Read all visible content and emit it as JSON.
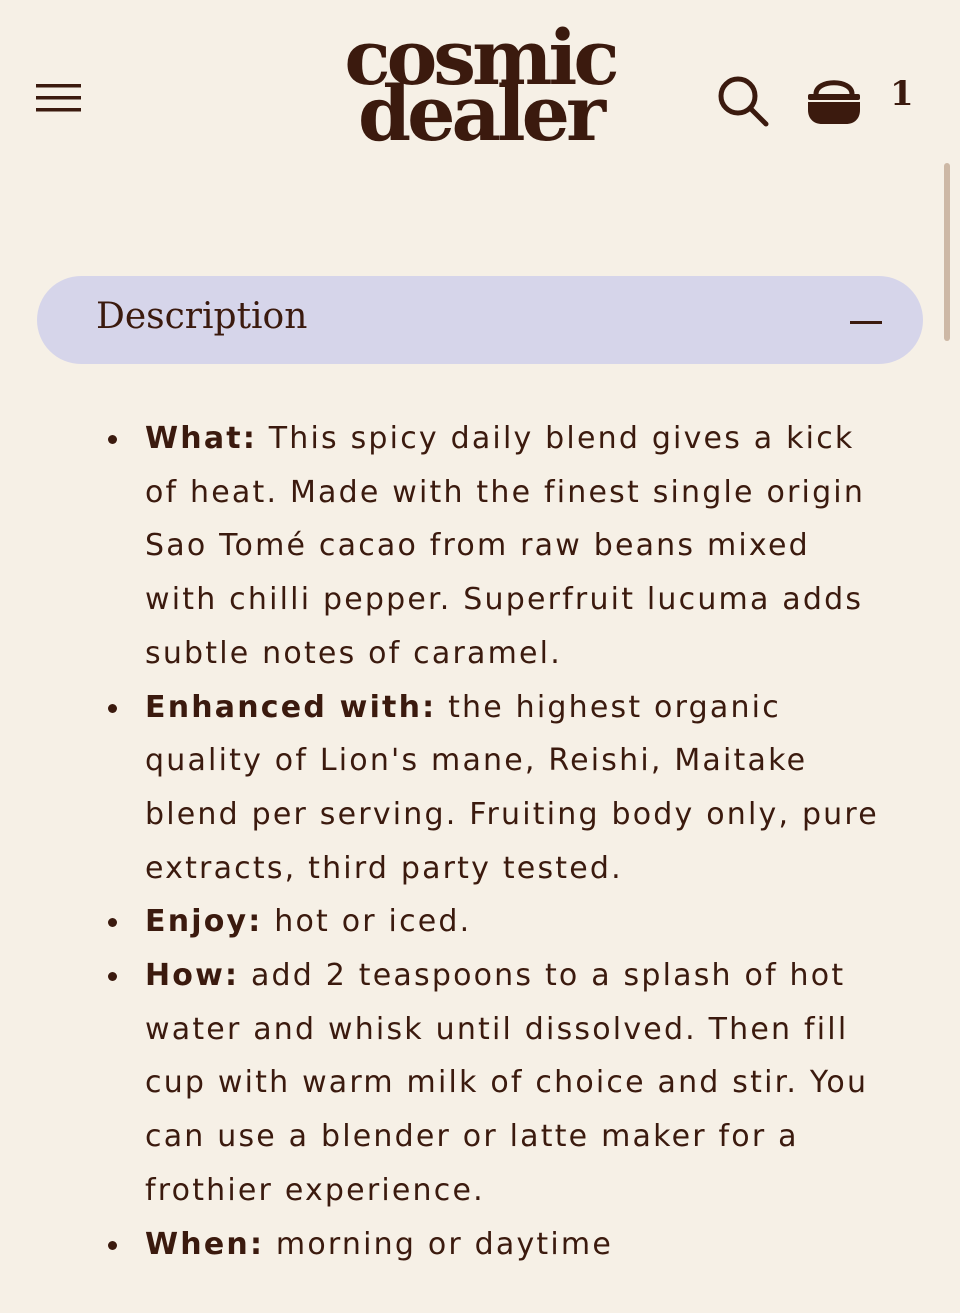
{
  "header": {
    "logo_line1": "cosmic",
    "logo_line2": "dealer",
    "cart_count": "1",
    "menu_icon": "hamburger-menu-icon",
    "search_icon": "search-icon",
    "cart_icon": "basket-icon"
  },
  "accordion": {
    "title": "Description",
    "state_icon": "minus-icon"
  },
  "description": {
    "items": [
      {
        "label": "What:",
        "text": " This spicy daily blend gives a kick of heat. Made with the finest single origin Sao Tomé cacao from raw beans mixed with chilli pepper. Superfruit lucuma adds subtle notes of caramel."
      },
      {
        "label": "Enhanced with:",
        "text": " the highest organic quality of Lion's mane, Reishi, Maitake blend per serving. Fruiting body only, pure extracts, third party tested."
      },
      {
        "label": "Enjoy:",
        "text": " hot or iced."
      },
      {
        "label": "How:",
        "text": " add 2 teaspoons to a splash of hot water and whisk until dissolved. Then fill cup with warm milk of choice and stir. You can use a blender or latte maker for a frothier experience."
      },
      {
        "label": "When:",
        "text": " morning or daytime"
      }
    ]
  },
  "colors": {
    "background": "#f6f0e6",
    "text": "#3b1a0e",
    "accordion_bg": "#d6d5ea"
  }
}
